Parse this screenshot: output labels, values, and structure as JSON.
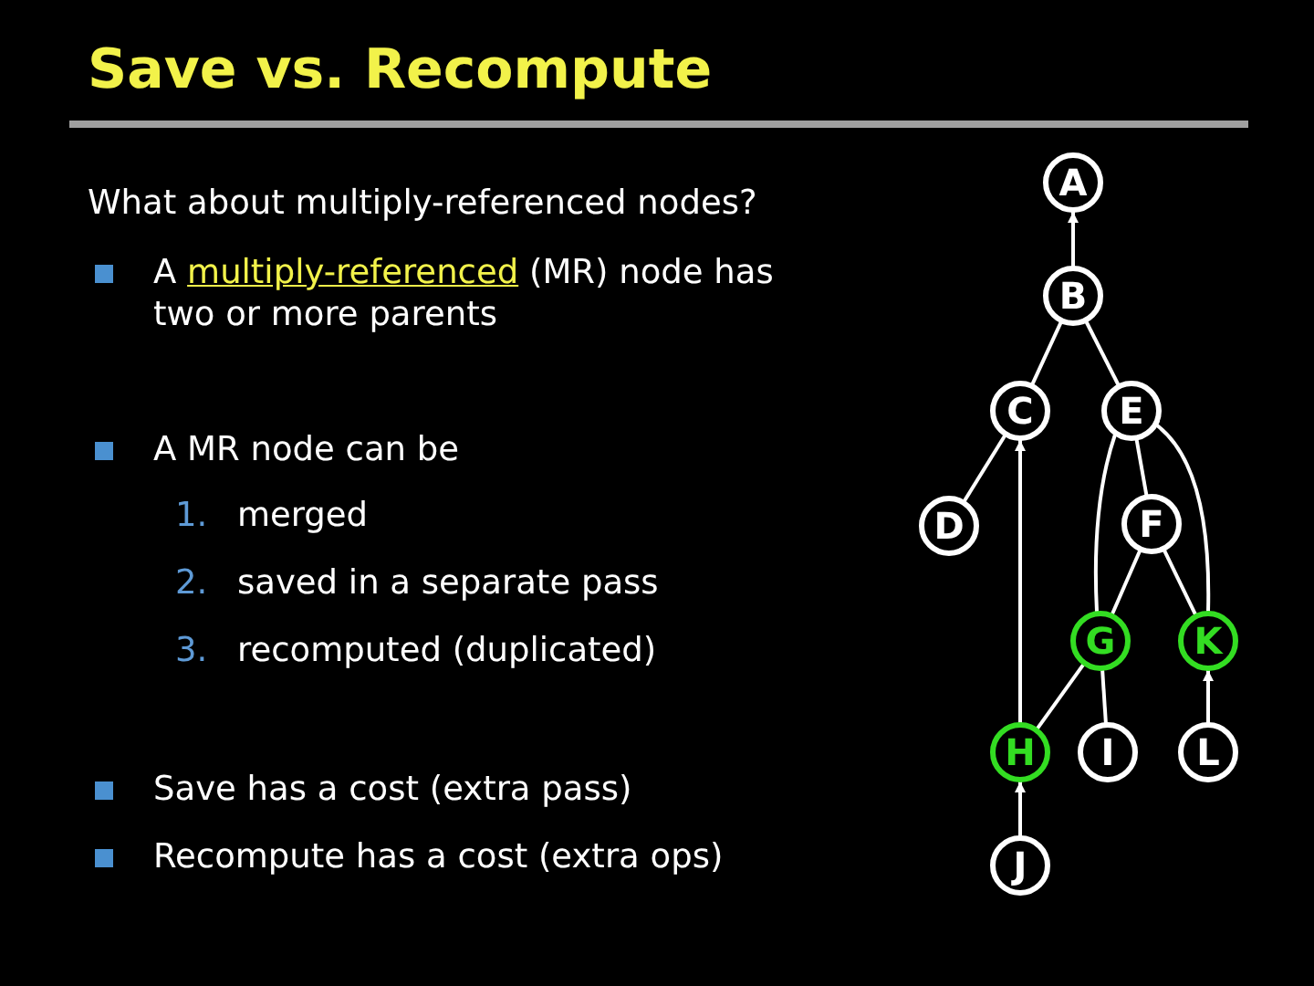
{
  "slide": {
    "title": "Save vs. Recompute",
    "intro": "What about multiply-referenced nodes?",
    "bullets": [
      {
        "kind": "term",
        "before": "A ",
        "term": "multiply-referenced",
        "after": " (MR) node has two or more parents"
      },
      {
        "kind": "list",
        "text": "A MR node can be",
        "items": [
          {
            "number": "1.",
            "text": "merged"
          },
          {
            "number": "2.",
            "text": "saved in a separate pass"
          },
          {
            "number": "3.",
            "text": "recomputed (duplicated)"
          }
        ]
      },
      {
        "kind": "plain",
        "text": "Save has a cost (extra pass)"
      },
      {
        "kind": "plain",
        "text": "Recompute has a cost (extra ops)"
      }
    ]
  },
  "graph": {
    "nodes": [
      {
        "label": "A",
        "highlighted": false
      },
      {
        "label": "B",
        "highlighted": false
      },
      {
        "label": "C",
        "highlighted": false
      },
      {
        "label": "E",
        "highlighted": false
      },
      {
        "label": "D",
        "highlighted": false
      },
      {
        "label": "F",
        "highlighted": false
      },
      {
        "label": "G",
        "highlighted": true
      },
      {
        "label": "K",
        "highlighted": true
      },
      {
        "label": "H",
        "highlighted": true
      },
      {
        "label": "I",
        "highlighted": false
      },
      {
        "label": "L",
        "highlighted": false
      },
      {
        "label": "J",
        "highlighted": false
      }
    ]
  }
}
